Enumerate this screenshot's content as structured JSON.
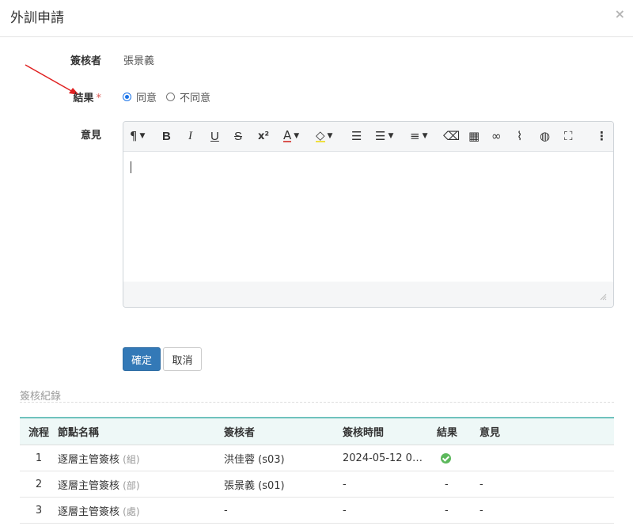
{
  "dialog": {
    "title": "外訓申請",
    "close_label": "×"
  },
  "form": {
    "reviewer_label": "簽核者",
    "reviewer_value": "張景義",
    "result_label": "結果",
    "required_mark": "*",
    "result_options": [
      {
        "label": "同意",
        "checked": true
      },
      {
        "label": "不同意",
        "checked": false
      }
    ],
    "comment_label": "意見",
    "comment_value": ""
  },
  "toolbar": {
    "items": [
      {
        "name": "paragraph-format-icon",
        "glyph": "¶",
        "caret": true
      },
      {
        "name": "bold-icon",
        "glyph": "B"
      },
      {
        "name": "italic-icon",
        "glyph": "I"
      },
      {
        "name": "underline-icon",
        "glyph": "U"
      },
      {
        "name": "strikethrough-icon",
        "glyph": "S"
      },
      {
        "name": "superscript-icon",
        "glyph": "x²"
      },
      {
        "name": "text-color-icon",
        "glyph": "A",
        "caret": true
      },
      {
        "name": "background-color-icon",
        "glyph": "◇",
        "caret": true
      },
      {
        "name": "ordered-list-icon",
        "glyph": "☰"
      },
      {
        "name": "unordered-list-icon",
        "glyph": "☰",
        "caret": true
      },
      {
        "name": "align-icon",
        "glyph": "≡",
        "caret": true
      },
      {
        "name": "clear-formatting-icon",
        "glyph": "⌫"
      },
      {
        "name": "table-icon",
        "glyph": "▦"
      },
      {
        "name": "link-icon",
        "glyph": "∞"
      },
      {
        "name": "attachment-icon",
        "glyph": "⌇"
      },
      {
        "name": "globe-icon",
        "glyph": "◍"
      },
      {
        "name": "fullscreen-icon",
        "glyph": "⛶"
      },
      {
        "name": "more-options-icon",
        "glyph": "⋮"
      }
    ]
  },
  "actions": {
    "confirm_label": "確定",
    "cancel_label": "取消"
  },
  "history": {
    "section_title": "簽核紀錄",
    "columns": [
      "流程",
      "節點名稱",
      "簽核者",
      "簽核時間",
      "結果",
      "意見"
    ],
    "rows": [
      {
        "step": "1",
        "node": "逐層主管簽核",
        "node_tag": "(組)",
        "reviewer": "洪佳蓉 (s03)",
        "time": "2024-05-12 0…",
        "result": "approved",
        "result_text": "",
        "comment": ""
      },
      {
        "step": "2",
        "node": "逐層主管簽核",
        "node_tag": "(部)",
        "reviewer": "張景義 (s01)",
        "time": "-",
        "result": "none",
        "result_text": "-",
        "comment": "-"
      },
      {
        "step": "3",
        "node": "逐層主管簽核",
        "node_tag": "(處)",
        "reviewer": "-",
        "time": "-",
        "result": "none",
        "result_text": "-",
        "comment": "-"
      }
    ]
  },
  "colors": {
    "primary": "#3379b7",
    "annotation_arrow": "#e02020",
    "table_accent": "#6fc2bd",
    "approved": "#5cb85c"
  }
}
